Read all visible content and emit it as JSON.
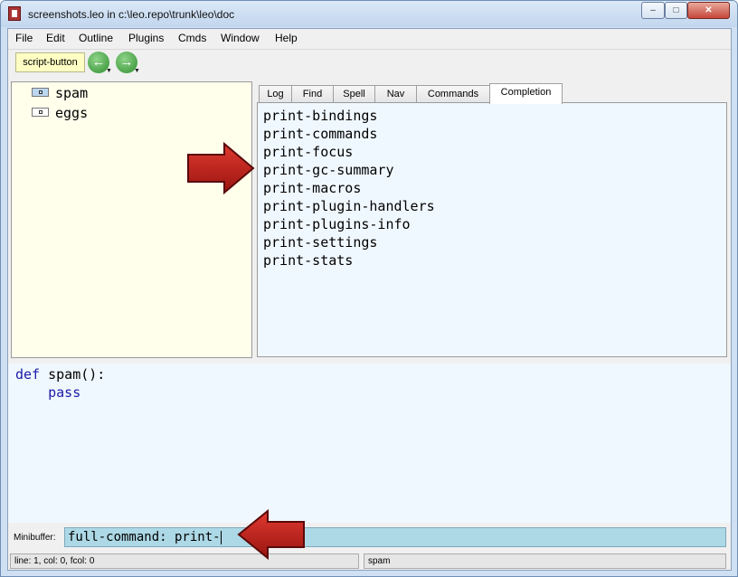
{
  "window": {
    "title": "screenshots.leo in c:\\leo.repo\\trunk\\leo\\doc",
    "controls": {
      "minimize": "–",
      "maximize": "□",
      "close": "✕"
    }
  },
  "menu": [
    "File",
    "Edit",
    "Outline",
    "Plugins",
    "Cmds",
    "Window",
    "Help"
  ],
  "toolbar": {
    "script_button": "script-button",
    "back_icon": "←",
    "forward_icon": "→"
  },
  "outline": {
    "nodes": [
      "spam",
      "eggs"
    ],
    "selected": "spam"
  },
  "tabs": [
    "Log",
    "Find",
    "Spell",
    "Nav",
    "Commands",
    "Completion"
  ],
  "active_tab": "Completion",
  "completions": [
    "print-bindings",
    "print-commands",
    "print-focus",
    "print-gc-summary",
    "print-macros",
    "print-plugin-handlers",
    "print-plugins-info",
    "print-settings",
    "print-stats"
  ],
  "body": {
    "keyword": "def",
    "signature": " spam():",
    "indent": "    ",
    "line2": "pass"
  },
  "minibuffer": {
    "label": "Minibuffer:",
    "value": "full-command: print-"
  },
  "status": {
    "position": "line: 1, col: 0, fcol: 0",
    "headline": "spam"
  },
  "colors": {
    "outline_bg": "#ffffec",
    "log_bg": "#f0f8ff",
    "minibuffer_bg": "#add8e6",
    "keyword": "#1a1aa6",
    "arrow": "#c0201a"
  }
}
